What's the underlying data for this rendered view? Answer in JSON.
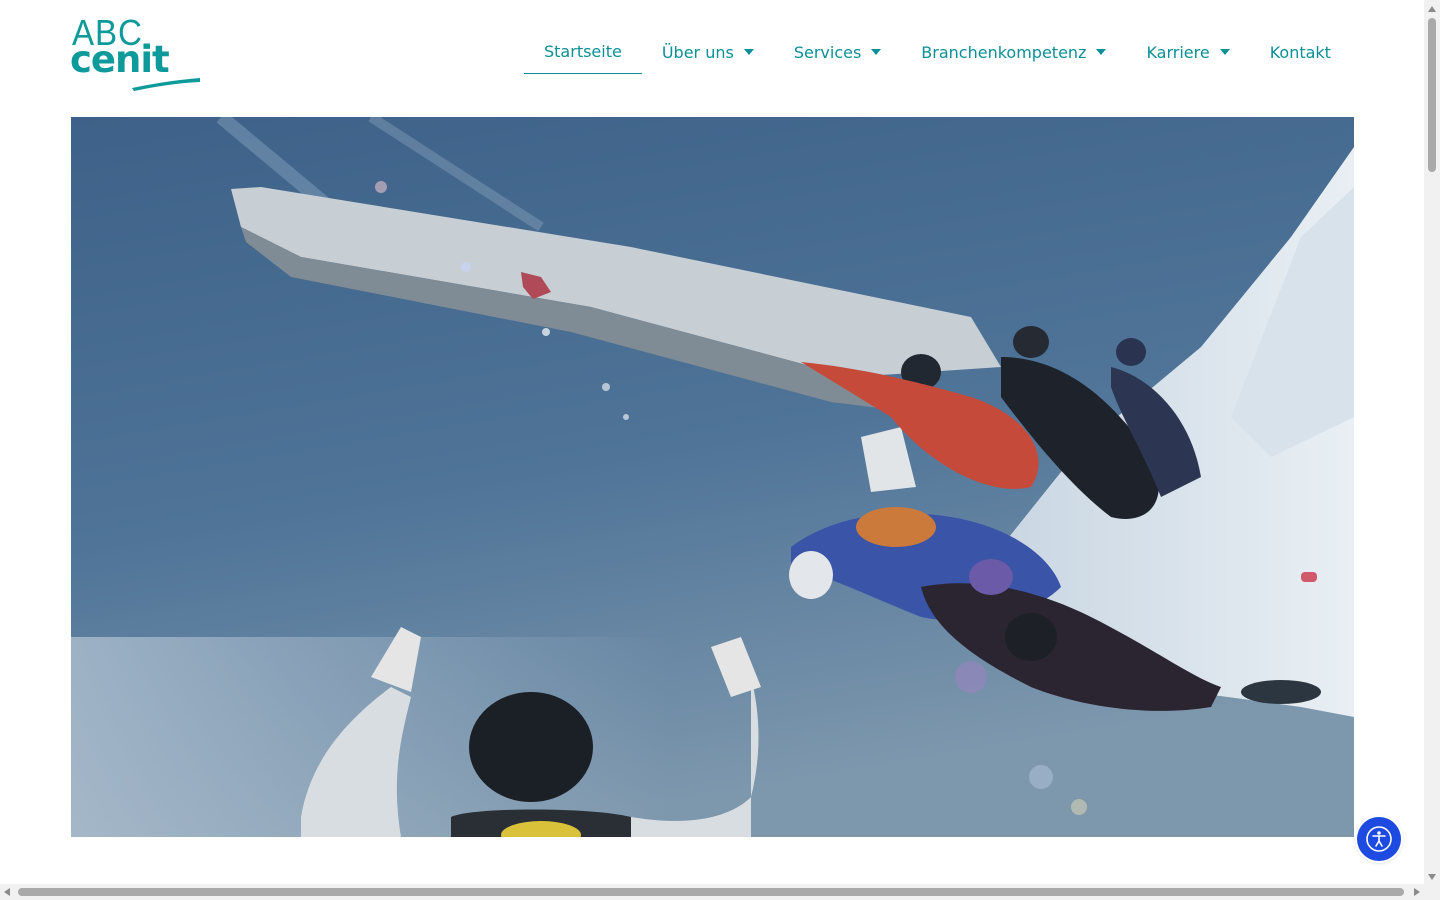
{
  "brand": {
    "logo_line1": "ABC",
    "logo_line2": "cenit",
    "color": "#0e9a9a"
  },
  "nav": {
    "items": [
      {
        "label": "Startseite",
        "active": true,
        "has_dropdown": false
      },
      {
        "label": "Über uns",
        "active": false,
        "has_dropdown": true
      },
      {
        "label": "Services",
        "active": false,
        "has_dropdown": true
      },
      {
        "label": "Branchenkompetenz",
        "active": false,
        "has_dropdown": true
      },
      {
        "label": "Karriere",
        "active": false,
        "has_dropdown": true
      },
      {
        "label": "Kontakt",
        "active": false,
        "has_dropdown": false
      }
    ],
    "link_color": "#0c8f96"
  },
  "hero": {
    "media": "video-still-skydivers-leaving-aircraft"
  },
  "accessibility_widget": {
    "icon": "accessibility-person-icon",
    "color": "#1d4ae0"
  }
}
